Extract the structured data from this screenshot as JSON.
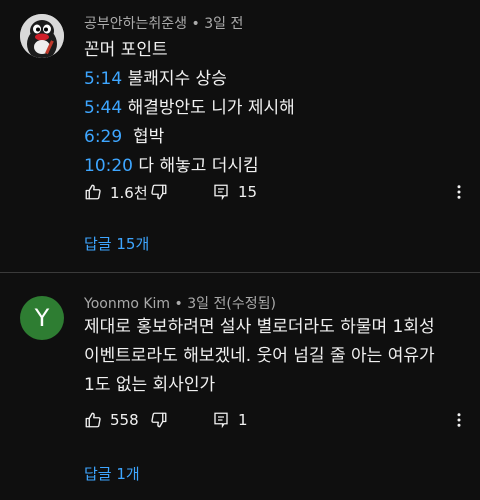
{
  "comments": [
    {
      "author": "공부안하는취준생",
      "time": "3일 전",
      "lines": [
        {
          "text": "꼰머 포인트"
        },
        {
          "timestamp": "5:14",
          "text": "불쾌지수 상승"
        },
        {
          "timestamp": "5:44",
          "text": "해결방안도 니가 제시해"
        },
        {
          "timestamp": "6:29",
          "text": "협박"
        },
        {
          "timestamp": "10:20",
          "text": "다 해놓고 더시킴"
        }
      ],
      "likes": "1.6천",
      "reply_count": "15",
      "replies_link": "답글 15개"
    },
    {
      "author": "Yoonmo Kim",
      "time": "3일 전(수정됨)",
      "avatar_letter": "Y",
      "avatar_color": "#2e7d32",
      "lines": [
        {
          "text": "제대로 홍보하려면 설사 별로더라도 하물며 1회성"
        },
        {
          "text": "이벤트로라도 해보겠네. 웃어 넘길 줄 아는 여유가"
        },
        {
          "text": "1도 없는 회사인가"
        }
      ],
      "likes": "558",
      "reply_count": "1",
      "replies_link": "답글 1개"
    }
  ],
  "separator": "•",
  "colors": {
    "background": "#0f0f0f",
    "link": "#3ea6ff",
    "meta": "#aaaaaa"
  },
  "icons": [
    "thumbs-up-icon",
    "thumbs-down-icon",
    "reply-comment-icon",
    "more-vert-icon"
  ]
}
